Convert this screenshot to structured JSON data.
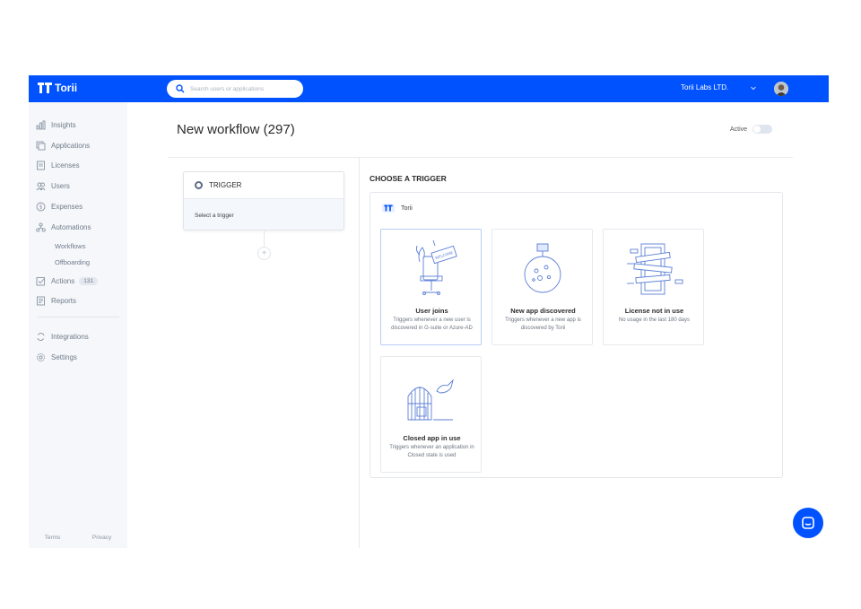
{
  "topbar": {
    "logo_text": "Torii",
    "search_placeholder": "Search users or applications",
    "org_name": "Torii Labs LTD.",
    "brand_color": "#0052ff"
  },
  "sidebar": {
    "items": [
      {
        "label": "Insights",
        "icon": "insights-icon"
      },
      {
        "label": "Applications",
        "icon": "applications-icon"
      },
      {
        "label": "Licenses",
        "icon": "licenses-icon"
      },
      {
        "label": "Users",
        "icon": "users-icon"
      },
      {
        "label": "Expenses",
        "icon": "expenses-icon"
      },
      {
        "label": "Automations",
        "icon": "automations-icon"
      },
      {
        "label": "Workflows"
      },
      {
        "label": "Offboarding"
      },
      {
        "label": "Actions",
        "icon": "actions-icon",
        "badge": "131"
      },
      {
        "label": "Reports",
        "icon": "reports-icon"
      },
      {
        "label": "Integrations",
        "icon": "integrations-icon"
      },
      {
        "label": "Settings",
        "icon": "settings-icon"
      }
    ],
    "footer": {
      "terms": "Terms",
      "privacy": "Privacy"
    }
  },
  "main": {
    "title": "New workflow (297)",
    "active_label": "Active",
    "active_on": false,
    "trigger": {
      "heading": "TRIGGER",
      "placeholder": "Select a trigger"
    },
    "chooser": {
      "title": "CHOOSE A TRIGGER",
      "source": "Torii",
      "cards": [
        {
          "name": "User joins",
          "desc": "Triggers whenever a new user is discovered in G-suite or Azure-AD",
          "illustration": "user-joins-illustration",
          "welcome_text": "WELCOME"
        },
        {
          "name": "New app discovered",
          "desc": "Triggers whenever a new app is discovered by Torii",
          "illustration": "new-app-illustration"
        },
        {
          "name": "License not in use",
          "desc": "No usage in the last 180 days",
          "illustration": "license-illustration"
        },
        {
          "name": "Closed app in use",
          "desc": "Triggers whenever an application in Closed state is used",
          "illustration": "closed-app-illustration"
        }
      ]
    }
  }
}
